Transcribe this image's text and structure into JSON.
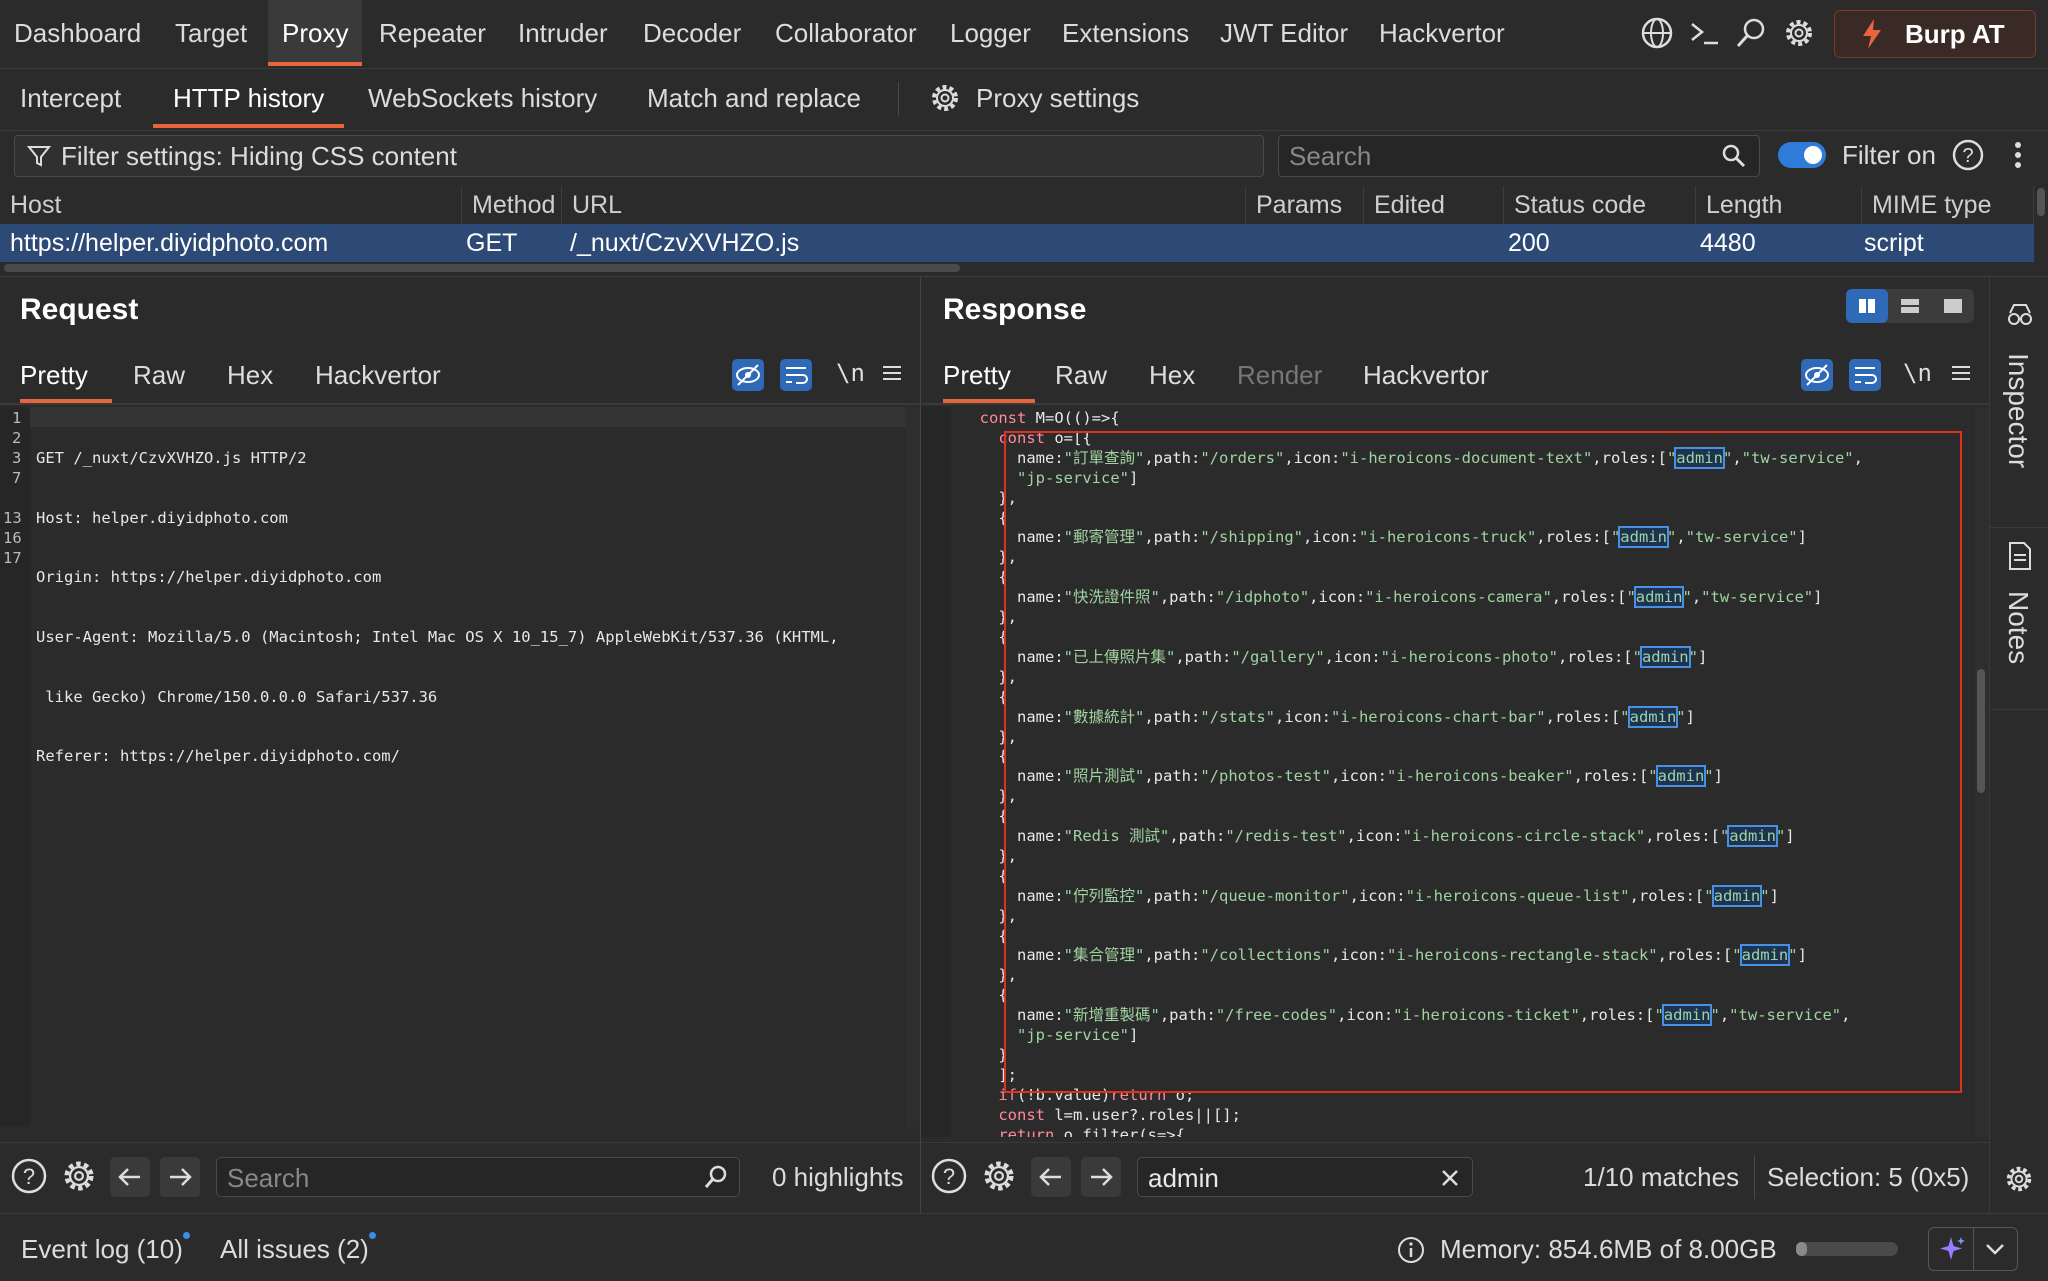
{
  "top_nav": {
    "items": [
      "Dashboard",
      "Target",
      "Proxy",
      "Repeater",
      "Intruder",
      "Decoder",
      "Collaborator",
      "Logger",
      "Extensions",
      "JWT Editor",
      "Hackvertor"
    ],
    "active": "Proxy",
    "burp_label": "Burp AT"
  },
  "sub_nav": {
    "items": [
      "Intercept",
      "HTTP history",
      "WebSockets history",
      "Match and replace"
    ],
    "active": "HTTP history",
    "settings_label": "Proxy settings"
  },
  "filter": {
    "label": "Filter settings: Hiding CSS content",
    "search_placeholder": "Search",
    "filter_on_label": "Filter on"
  },
  "table": {
    "headers": [
      "Host",
      "Method",
      "URL",
      "Params",
      "Edited",
      "Status code",
      "Length",
      "MIME type"
    ],
    "rows": [
      {
        "host": "https://helper.diyidphoto.com",
        "method": "GET",
        "url": "/_nuxt/CzvXVHZO.js",
        "params": "",
        "edited": "",
        "status": "200",
        "length": "4480",
        "mime": "script"
      }
    ]
  },
  "request": {
    "title": "Request",
    "tabs": [
      "Pretty",
      "Raw",
      "Hex",
      "Hackvertor"
    ],
    "active_tab": "Pretty",
    "newline_label": "\\n",
    "line_numbers": [
      "1",
      "2",
      "3",
      "7",
      "",
      "13",
      "16",
      "17"
    ],
    "lines": [
      "GET /_nuxt/CzvXVHZO.js HTTP/2",
      "Host: helper.diyidphoto.com",
      "Origin: https://helper.diyidphoto.com",
      "User-Agent: Mozilla/5.0 (Macintosh; Intel Mac OS X 10_15_7) AppleWebKit/537.36 (KHTML,",
      " like Gecko) Chrome/150.0.0.0 Safari/537.36",
      "Referer: https://helper.diyidphoto.com/",
      ""
    ],
    "search_placeholder": "Search",
    "highlights": "0 highlights"
  },
  "response": {
    "title": "Response",
    "tabs": [
      "Pretty",
      "Raw",
      "Hex",
      "Render",
      "Hackvertor"
    ],
    "active_tab": "Pretty",
    "newline_label": "\\n",
    "lines": [
      "  const M=O(()=>{",
      "    const o=[{",
      "      name:\"訂單查詢\",path:\"/orders\",icon:\"i-heroicons-document-text\",roles:[\"admin\",\"tw-service\",",
      "      \"jp-service\"]",
      "    },",
      "    {",
      "      name:\"郵寄管理\",path:\"/shipping\",icon:\"i-heroicons-truck\",roles:[\"admin\",\"tw-service\"]",
      "    },",
      "    {",
      "      name:\"快洗證件照\",path:\"/idphoto\",icon:\"i-heroicons-camera\",roles:[\"admin\",\"tw-service\"]",
      "    },",
      "    {",
      "      name:\"已上傳照片集\",path:\"/gallery\",icon:\"i-heroicons-photo\",roles:[\"admin\"]",
      "    },",
      "    {",
      "      name:\"數據統計\",path:\"/stats\",icon:\"i-heroicons-chart-bar\",roles:[\"admin\"]",
      "    },",
      "    {",
      "      name:\"照片測試\",path:\"/photos-test\",icon:\"i-heroicons-beaker\",roles:[\"admin\"]",
      "    },",
      "    {",
      "      name:\"Redis 測試\",path:\"/redis-test\",icon:\"i-heroicons-circle-stack\",roles:[\"admin\"]",
      "    },",
      "    {",
      "      name:\"佇列監控\",path:\"/queue-monitor\",icon:\"i-heroicons-queue-list\",roles:[\"admin\"]",
      "    },",
      "    {",
      "      name:\"集合管理\",path:\"/collections\",icon:\"i-heroicons-rectangle-stack\",roles:[\"admin\"]",
      "    },",
      "    {",
      "      name:\"新增重製碼\",path:\"/free-codes\",icon:\"i-heroicons-ticket\",roles:[\"admin\",\"tw-service\",",
      "      \"jp-service\"]",
      "    }",
      "    ];",
      "    if(!b.value)return o;",
      "    const l=m.user?.roles||[];",
      "    return o.filter(s=>{"
    ],
    "search_value": "admin",
    "matches": "1/10 matches",
    "selection": "Selection: 5 (0x5)"
  },
  "side_panel": {
    "inspector": "Inspector",
    "notes": "Notes"
  },
  "status_bar": {
    "event_log": "Event log (10)",
    "all_issues": "All issues (2)",
    "memory": "Memory: 854.6MB of 8.00GB",
    "memory_fraction": 0.107
  },
  "colors": {
    "accent": "#e8643c",
    "selected_row": "#2c4a75",
    "highlight_box": "#e0301e",
    "toggle": "#2f7bd8"
  }
}
